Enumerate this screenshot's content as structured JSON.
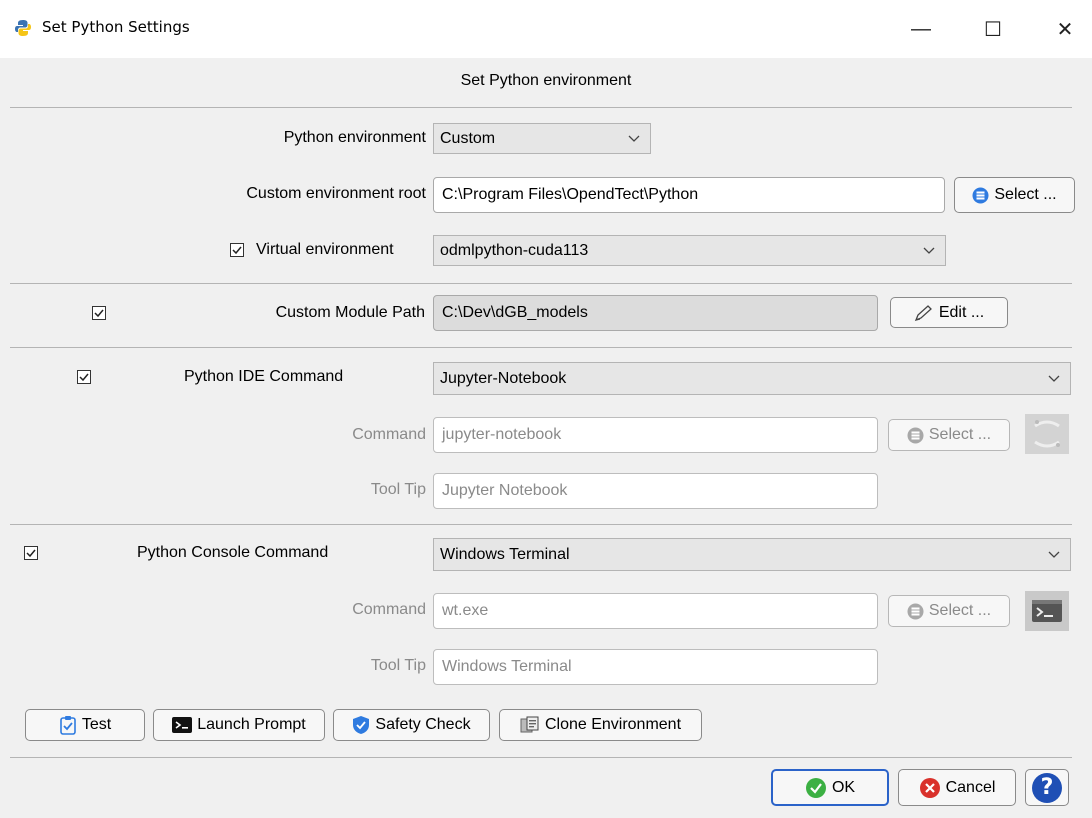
{
  "window": {
    "title": "Set Python Settings",
    "minimize_glyph": "—",
    "maximize_glyph": "☐",
    "close_glyph": "✕"
  },
  "header": {
    "subtitle": "Set Python environment"
  },
  "environment": {
    "python_env_label": "Python environment",
    "python_env_value": "Custom",
    "root_label": "Custom environment root",
    "root_value": "C:\\Program Files\\OpendTect\\Python",
    "select_label": "Select ...",
    "venv_label": "Virtual environment",
    "venv_checked": true,
    "venv_value": "odmlpython-cuda113"
  },
  "module_path": {
    "checked": true,
    "label": "Custom Module Path",
    "value": "C:\\Dev\\dGB_models",
    "edit_label": "Edit ..."
  },
  "ide": {
    "checked": true,
    "label": "Python IDE Command",
    "value": "Jupyter-Notebook",
    "command_label": "Command",
    "command_value": "jupyter-notebook",
    "select_label": "Select ...",
    "tooltip_label": "Tool Tip",
    "tooltip_value": "Jupyter Notebook"
  },
  "console": {
    "checked": true,
    "label": "Python Console Command",
    "value": "Windows Terminal",
    "command_label": "Command",
    "command_value": "wt.exe",
    "select_label": "Select ...",
    "tooltip_label": "Tool Tip",
    "tooltip_value": "Windows Terminal"
  },
  "actions": {
    "test": "Test",
    "launch_prompt": "Launch Prompt",
    "safety_check": "Safety Check",
    "clone_environment": "Clone Environment"
  },
  "footer": {
    "ok": "OK",
    "cancel": "Cancel",
    "help": "?"
  },
  "colors": {
    "ok_green": "#3cb043",
    "cancel_red": "#d9312b",
    "help_blue": "#1f4fb5",
    "select_blue": "#2f7be0",
    "primary_border": "#2b63c9"
  }
}
